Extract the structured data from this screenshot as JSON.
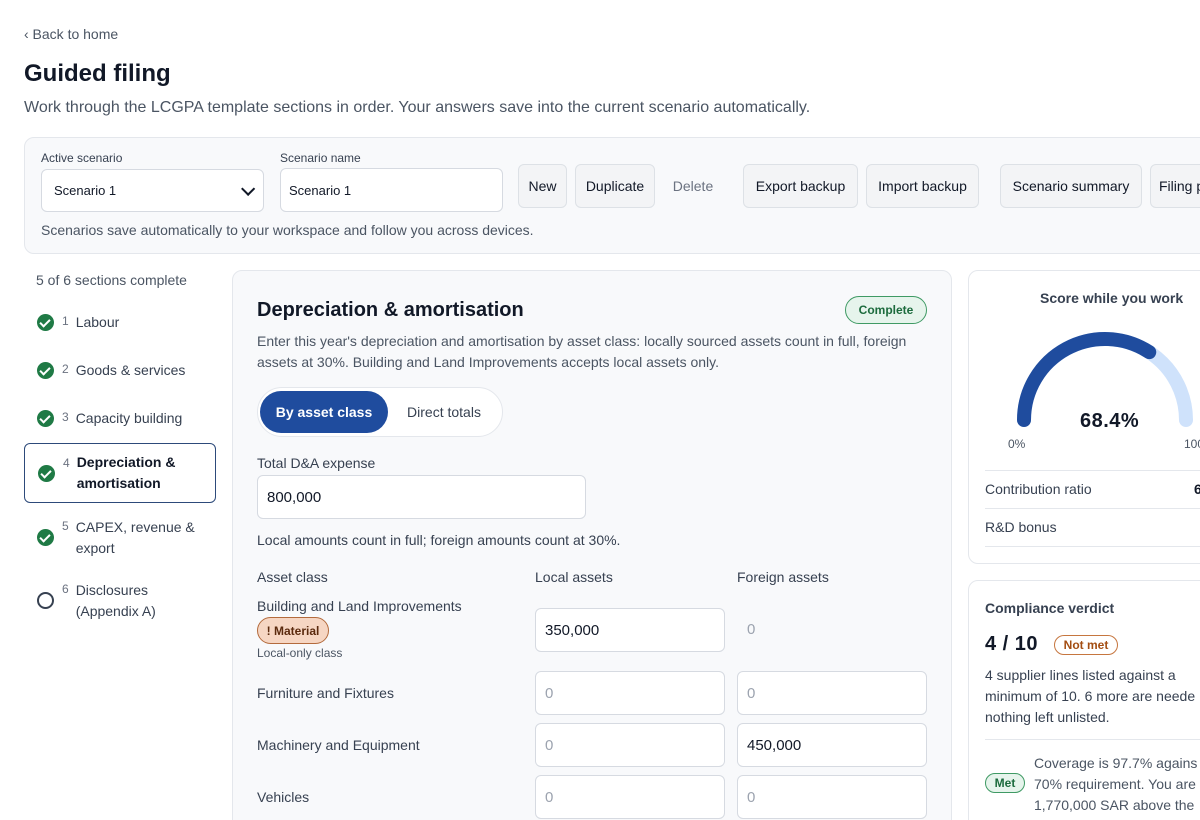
{
  "nav": {
    "back_label": "‹ Back to home"
  },
  "header": {
    "title": "Guided filing",
    "subtitle": "Work through the LCGPA template sections in order. Your answers save into the current scenario automatically."
  },
  "scenario": {
    "active_label": "Active scenario",
    "active_value": "Scenario 1",
    "name_label": "Scenario name",
    "name_value": "Scenario 1",
    "buttons": {
      "new": "New",
      "duplicate": "Duplicate",
      "delete": "Delete",
      "export": "Export backup",
      "import": "Import backup",
      "summary": "Scenario summary",
      "filing": "Filing p"
    },
    "note": "Scenarios save automatically to your workspace and follow you across devices."
  },
  "sidebar": {
    "progress": "5 of 6 sections complete",
    "items": [
      {
        "num": "1",
        "line1": "Labour",
        "line2": "",
        "done": true
      },
      {
        "num": "2",
        "line1": "Goods & services",
        "line2": "",
        "done": true
      },
      {
        "num": "3",
        "line1": "Capacity building",
        "line2": "",
        "done": true
      },
      {
        "num": "4",
        "line1": "Depreciation &",
        "line2": "amortisation",
        "done": true
      },
      {
        "num": "5",
        "line1": "CAPEX, revenue &",
        "line2": "export",
        "done": true
      },
      {
        "num": "6",
        "line1": "Disclosures",
        "line2": "(Appendix A)",
        "done": false
      }
    ]
  },
  "section": {
    "title": "Depreciation & amortisation",
    "status": "Complete",
    "description": "Enter this year's depreciation and amortisation by asset class: locally sourced assets count in full, foreign assets at 30%. Building and Land Improvements accepts local assets only.",
    "mode_on": "By asset class",
    "mode_off": "Direct totals",
    "total_label": "Total D&A expense",
    "total_value": "800,000",
    "rule_note": "Local amounts count in full; foreign amounts count at 30%.",
    "columns": {
      "asset": "Asset class",
      "local": "Local assets",
      "foreign": "Foreign assets"
    },
    "rows": [
      {
        "name": "Building and Land Improvements",
        "badge": "! Material",
        "note": "Local-only class",
        "local": "350,000",
        "foreign": "0"
      },
      {
        "name": "Furniture and Fixtures",
        "local": "0",
        "foreign": "0"
      },
      {
        "name": "Machinery and Equipment",
        "local": "0",
        "foreign": "450,000"
      },
      {
        "name": "Vehicles",
        "local": "0",
        "foreign": "0"
      }
    ]
  },
  "score": {
    "title": "Score while you work",
    "value": "68.4%",
    "fraction": 0.684,
    "min_label": "0%",
    "max_label": "100",
    "rows": [
      {
        "label": "Contribution ratio",
        "value": "6"
      },
      {
        "label": "R&D bonus",
        "value": ""
      }
    ]
  },
  "verdict": {
    "title": "Compliance verdict",
    "count": "4 / 10",
    "status": "Not met",
    "text_lines": [
      "4 supplier lines listed against a",
      "minimum of 10. 6 more are neede",
      "nothing left unlisted."
    ],
    "coverage_status": "Met",
    "coverage_lines": [
      "Coverage is 97.7% agains",
      "70% requirement. You are",
      "1,770,000 SAR above the"
    ]
  },
  "colors": {
    "primary": "#1f4c9e",
    "gauge_track": "#cfe2fb",
    "success": "#1f7a45",
    "warning": "#b36a3c"
  }
}
